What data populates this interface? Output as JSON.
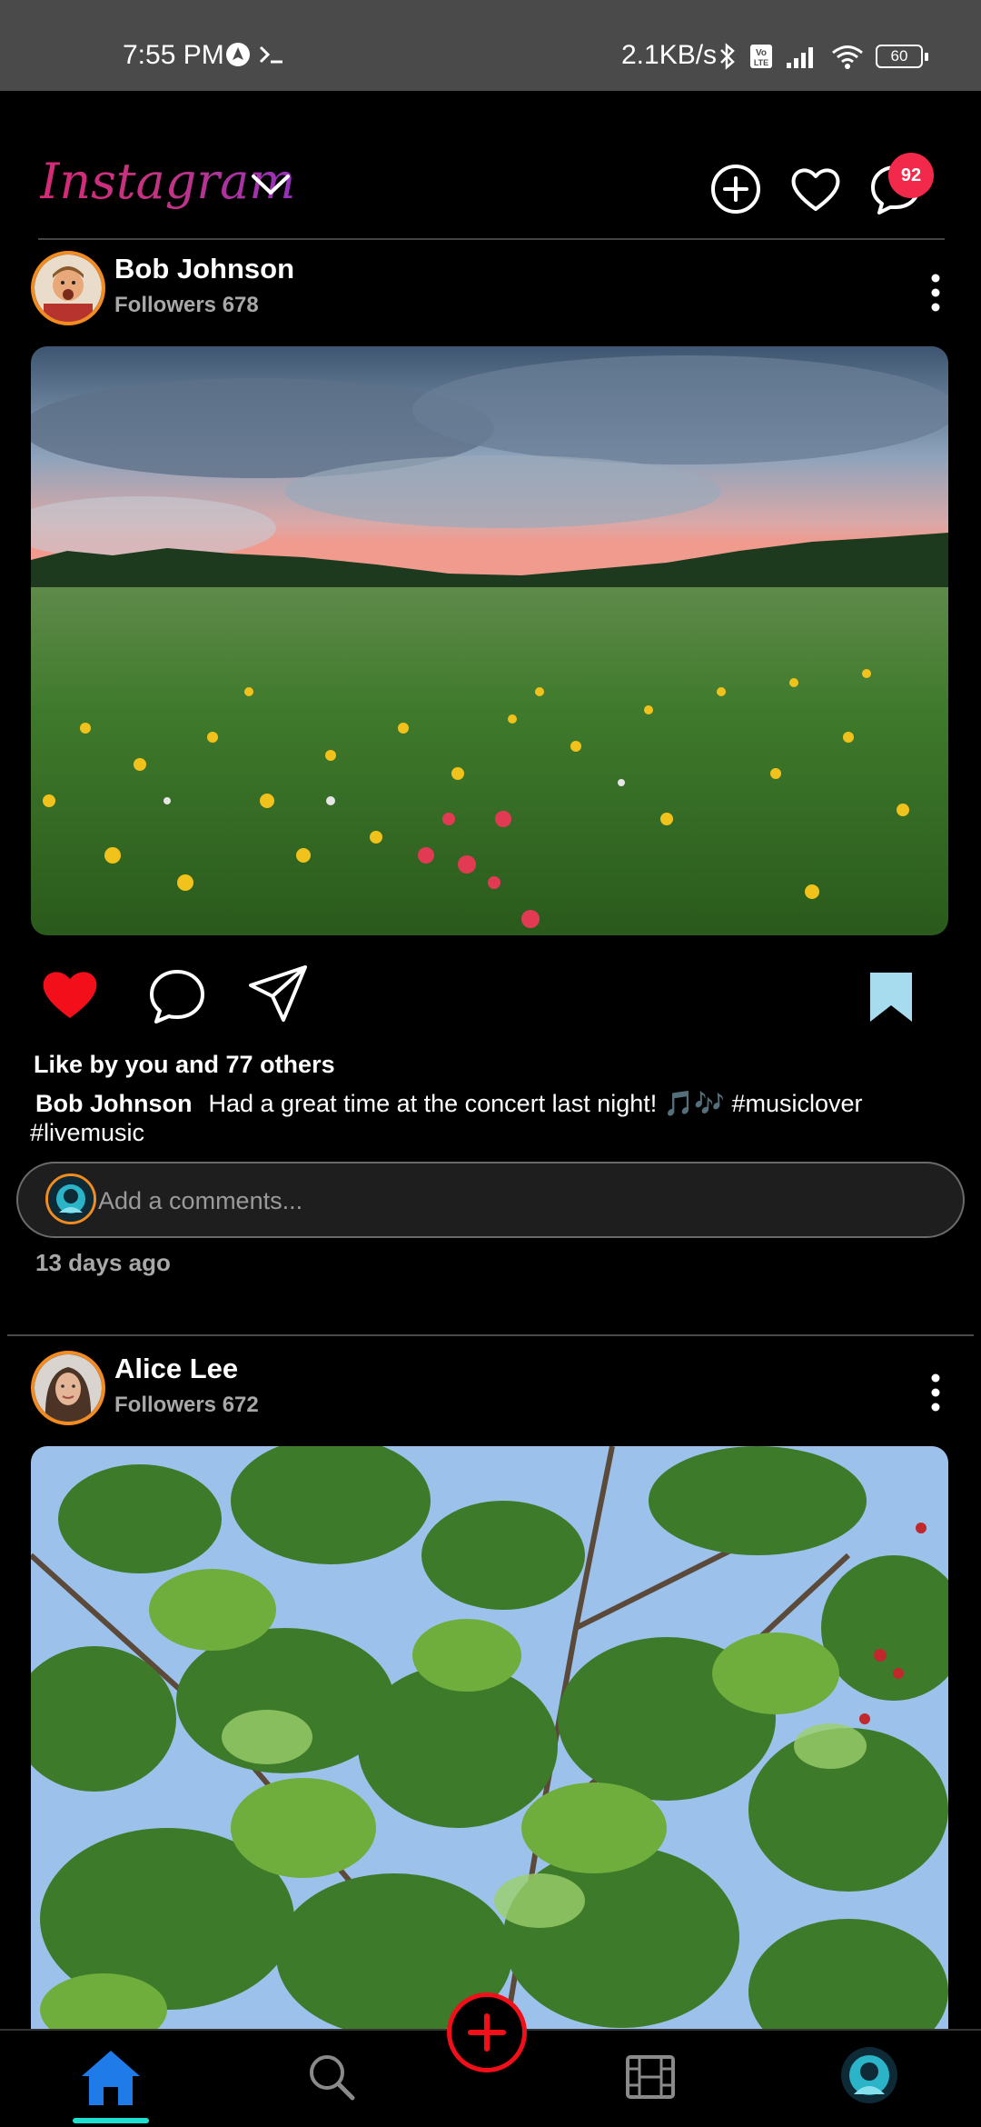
{
  "status_bar": {
    "time": "7:55 PM",
    "net_speed": "2.1KB/s",
    "battery": "60",
    "icons": [
      "navigation-icon",
      "terminal-icon",
      "bluetooth-icon",
      "volte-icon",
      "signal-icon",
      "wifi-icon",
      "battery-icon"
    ]
  },
  "header": {
    "logo": "Instagram",
    "notification_count": "92",
    "icons": [
      "chevron-down-icon",
      "add-circle-icon",
      "heart-icon",
      "messenger-icon"
    ]
  },
  "posts": [
    {
      "author": "Bob Johnson",
      "followers": "Followers 678",
      "likes": "Like by  you and 77 others",
      "caption_author": "Bob Johnson",
      "caption": "Had a great time at the concert last night! 🎵🎶 #musiclover #livemusic",
      "comment_placeholder": "Add a comments...",
      "time_ago": "13 days ago",
      "liked": true,
      "saved": true,
      "image": "meadow-sunset-photo"
    },
    {
      "author": "Alice Lee",
      "followers": "Followers 672",
      "image": "leaves-bird-photo"
    }
  ],
  "bottom_nav": {
    "items": [
      "home-icon",
      "search-icon",
      "add-icon",
      "reels-icon",
      "profile-avatar"
    ],
    "active": "home-icon"
  },
  "colors": {
    "like_red": "#f20f19",
    "save_blue": "#a6dced",
    "avatar_ring": "#f28b20",
    "active_underline": "#1ee0d0",
    "badge_red": "#f2294a"
  }
}
